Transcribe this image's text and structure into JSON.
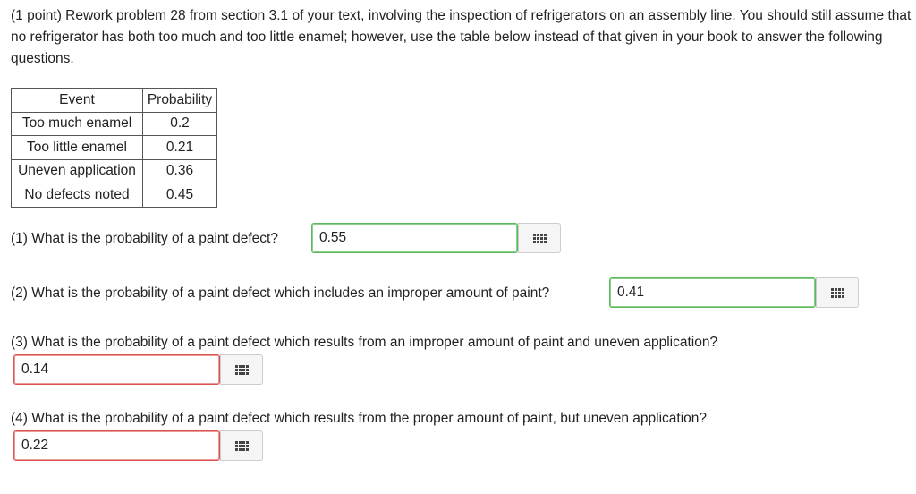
{
  "intro": "(1 point) Rework problem 28 from section 3.1 of your text, involving the inspection of refrigerators on an assembly line. You should still assume that no refrigerator has both too much and too little enamel; however, use the table below instead of that given in your book to answer the following questions.",
  "table": {
    "headers": [
      "Event",
      "Probability"
    ],
    "rows": [
      [
        "Too much enamel",
        "0.2"
      ],
      [
        "Too little enamel",
        "0.21"
      ],
      [
        "Uneven application",
        "0.36"
      ],
      [
        "No defects noted",
        "0.45"
      ]
    ]
  },
  "questions": [
    {
      "text": "(1) What is the probability of a paint defect?",
      "answer": "0.55",
      "status": "correct"
    },
    {
      "text": "(2) What is the probability of a paint defect which includes an improper amount of paint?",
      "answer": "0.41",
      "status": "correct"
    },
    {
      "text": "(3) What is the probability of a paint defect which results from an improper amount of paint and uneven application?",
      "answer": "0.14",
      "status": "incorrect"
    },
    {
      "text": "(4) What is the probability of a paint defect which results from the proper amount of paint, but uneven application?",
      "answer": "0.22",
      "status": "incorrect"
    }
  ],
  "icons": {
    "equation_editor": "grid-icon"
  },
  "colors": {
    "correct_border": "#5cb85c",
    "incorrect_border": "#d9534f"
  }
}
